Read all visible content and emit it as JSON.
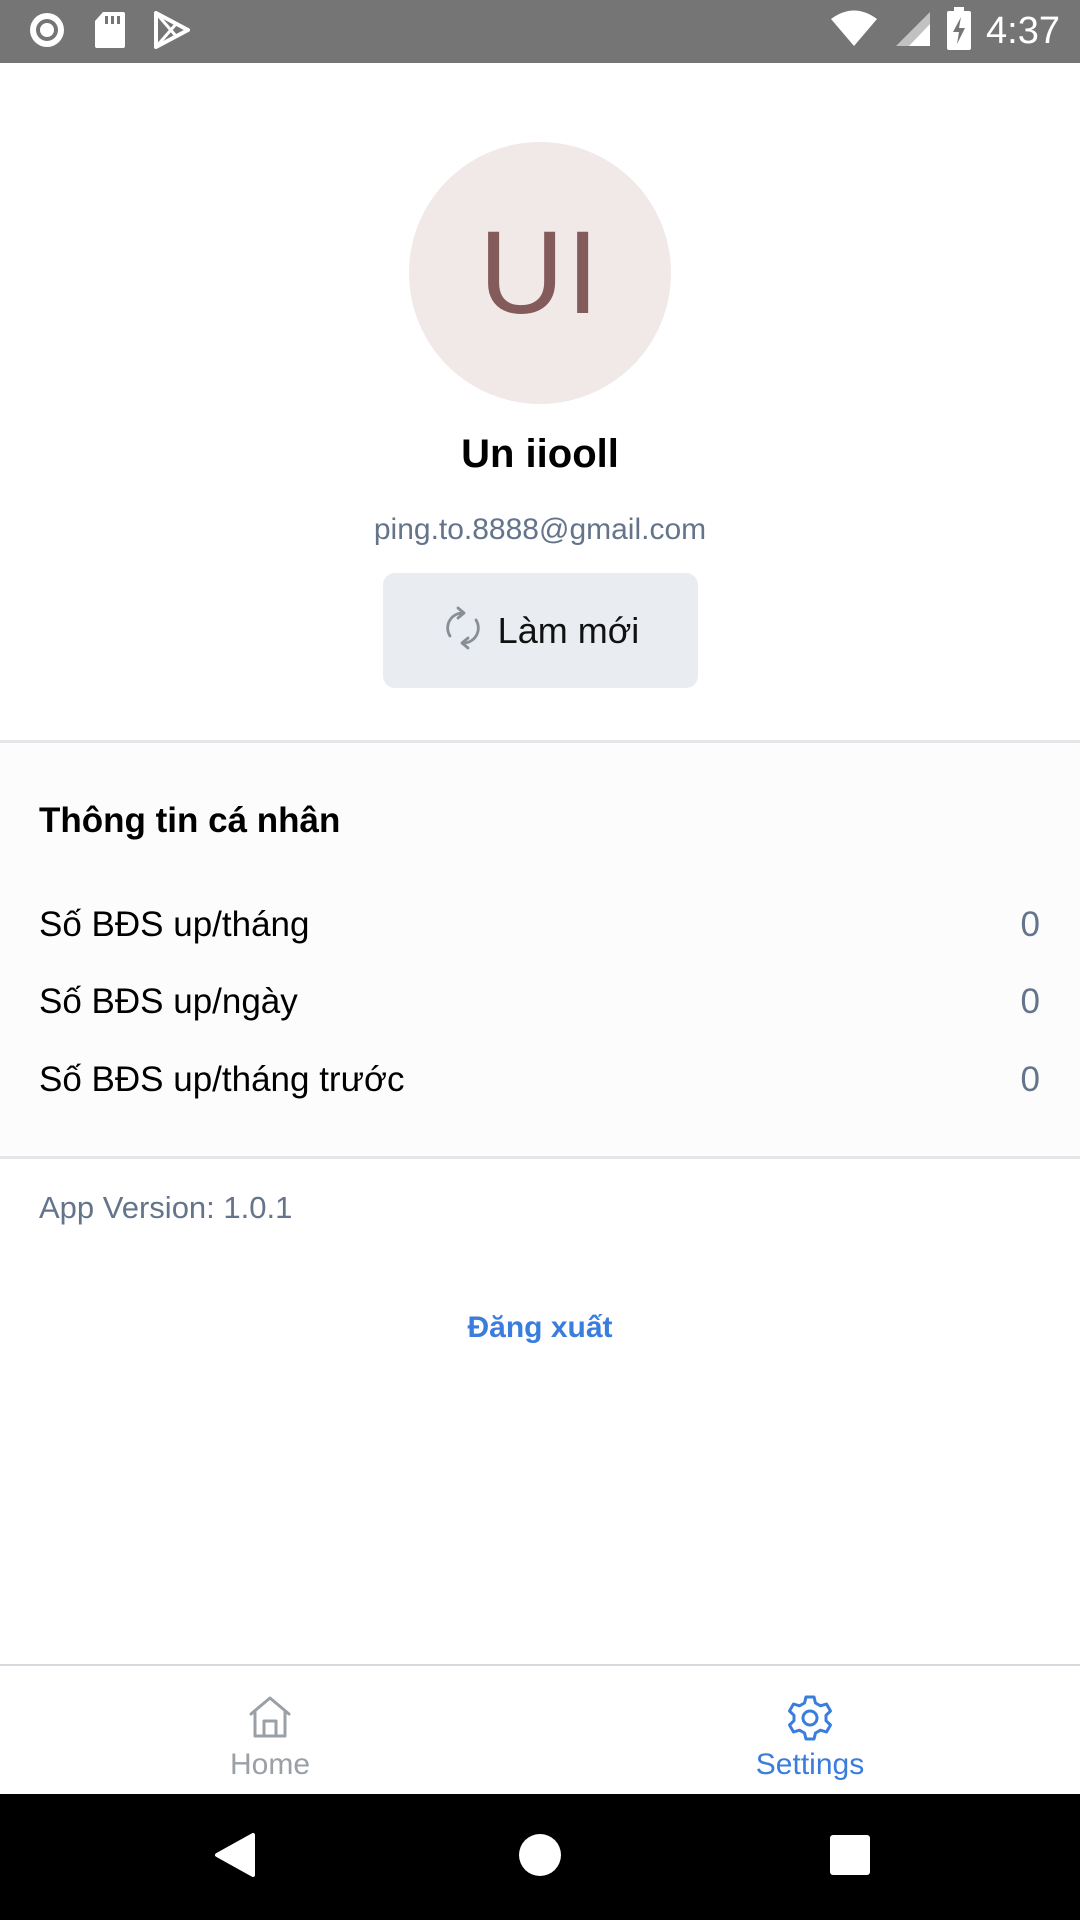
{
  "status_bar": {
    "time": "4:37",
    "left_icons": [
      "record-icon",
      "sd-card-icon",
      "play-store-icon"
    ],
    "right_icons": [
      "wifi-icon",
      "signal-icon",
      "battery-charging-icon"
    ]
  },
  "profile": {
    "initials": "UI",
    "name": "Un iiooll",
    "email": "ping.to.8888@gmail.com",
    "refresh_label": "Làm mới",
    "avatar_bg": "#f1e8e8",
    "avatar_text_color": "#845b5b"
  },
  "info": {
    "title": "Thông tin cá nhân",
    "rows": [
      {
        "label": "Số BĐS up/tháng",
        "value": "0"
      },
      {
        "label": "Số BĐS up/ngày",
        "value": "0"
      },
      {
        "label": "Số BĐS up/tháng trước",
        "value": "0"
      }
    ]
  },
  "app_version": "App Version: 1.0.1",
  "logout_label": "Đăng xuất",
  "tabs": [
    {
      "label": "Home",
      "icon": "home-icon",
      "active": false
    },
    {
      "label": "Settings",
      "icon": "gear-icon",
      "active": true
    }
  ],
  "colors": {
    "accent": "#3b7ddd",
    "muted": "#64748b",
    "status_bar": "#757575"
  }
}
